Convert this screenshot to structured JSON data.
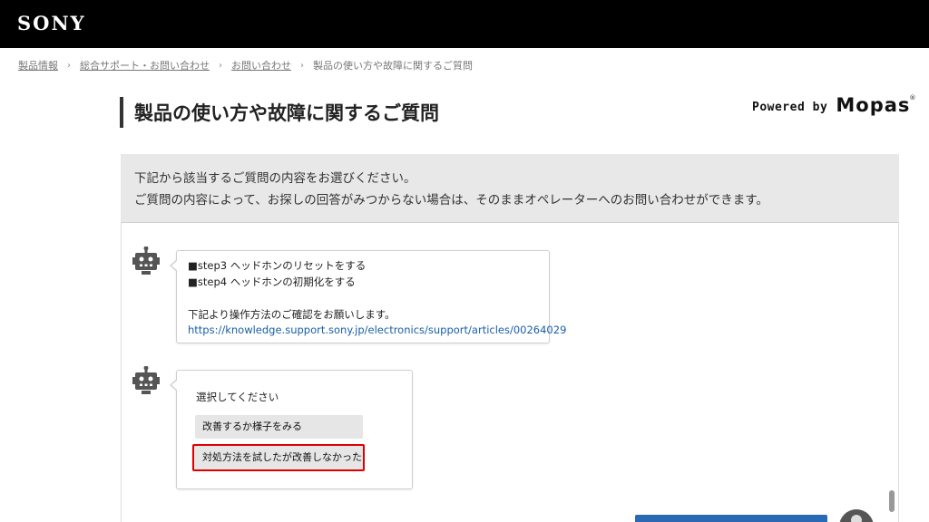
{
  "header": {
    "logo": "SONY"
  },
  "breadcrumb": {
    "items": [
      "製品情報",
      "総合サポート・お問い合わせ",
      "お問い合わせ"
    ],
    "current": "製品の使い方や故障に関するご質問",
    "separator": "›"
  },
  "page": {
    "title": "製品の使い方や故障に関するご質問",
    "powered_by": "Powered by",
    "brand": "Mopas",
    "registered": "®"
  },
  "info": {
    "line1": "下記から該当するご質問の内容をお選びください。",
    "line2": "ご質問の内容によって、お探しの回答がみつからない場合は、そのままオペレーターへのお問い合わせができます。"
  },
  "chat": {
    "message1": {
      "line1": "■step3 ヘッドホンのリセットをする",
      "line2": "■step4 ヘッドホンの初期化をする",
      "line3": "下記より操作方法のご確認をお願いします。",
      "link": "https://knowledge.support.sony.jp/electronics/support/articles/00264029"
    },
    "message2": {
      "prompt": "選択してください",
      "option1": "改善するか様子をみる",
      "option2": "対処方法を試したが改善しなかった"
    }
  },
  "colors": {
    "header_bg": "#000000",
    "info_bg": "#e8e8e8",
    "link": "#1a5fa8",
    "highlight": "#e00000",
    "operator_button": "#2a6ab5"
  }
}
